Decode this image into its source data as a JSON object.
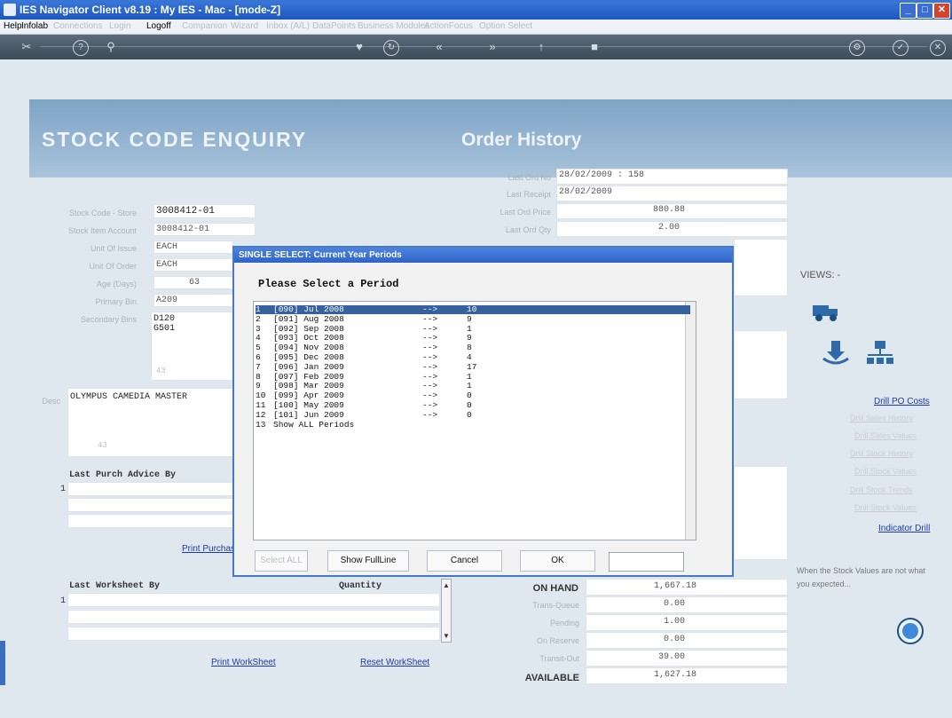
{
  "window": {
    "title": "IES Navigator Client v8.19 : My IES - Mac -     [mode-Z]"
  },
  "menu": [
    {
      "label": "Help",
      "on": true
    },
    {
      "label": "Infolab",
      "on": true
    },
    {
      "label": "Connections",
      "on": false
    },
    {
      "label": "Login",
      "on": false
    },
    {
      "label": "Logoff",
      "on": true
    },
    {
      "label": "Companion",
      "on": false
    },
    {
      "label": "Wizard",
      "on": false
    },
    {
      "label": "Inbox (A/L)",
      "on": false
    },
    {
      "label": "DataPoints",
      "on": false
    },
    {
      "label": "Business Modules",
      "on": false
    },
    {
      "label": "ActionFocus",
      "on": false
    },
    {
      "label": "Option Select",
      "on": false
    }
  ],
  "header": {
    "title": "STOCK   CODE   ENQUIRY",
    "subtitle": "Order History"
  },
  "left_fields": [
    {
      "label": "Stock Code - Store",
      "value": "3008412-01"
    },
    {
      "label": "Stock Item Account",
      "value": "3008412-01"
    },
    {
      "label": "Unit Of Issue",
      "value": "EACH"
    },
    {
      "label": "Unit Of Order",
      "value": "EACH"
    },
    {
      "label": "Age (Days)",
      "value": "63"
    },
    {
      "label": "Primary Bin",
      "value": "A209"
    },
    {
      "label": "Secondary Bins",
      "value": "D120\nG501"
    }
  ],
  "bins_extra": "43",
  "desc": {
    "label": "Desc",
    "value": "OLYMPUS CAMEDIA MASTER",
    "extra": "43"
  },
  "order_history": [
    {
      "label": "Last Ord No",
      "value": "28/02/2009 : 158"
    },
    {
      "label": "Last Receipt",
      "value": "28/02/2009"
    },
    {
      "label": "Last Ord Price",
      "value": "880.88"
    },
    {
      "label": "Last Ord Qty",
      "value": "2.00"
    }
  ],
  "purch_advice": {
    "header": "Last Purch Advice  By",
    "row_num": "1",
    "link": "Print Purchase"
  },
  "worksheet": {
    "header": "Last Worksheet   By",
    "qty_header": "Quantity",
    "row_num": "1",
    "link_print": "Print WorkSheet",
    "link_reset": "Reset WorkSheet"
  },
  "summary": {
    "on_hand_label": "ON HAND",
    "on_hand": "1,667.18",
    "rows": [
      {
        "label": "Trans-Queue",
        "value": "0.00"
      },
      {
        "label": "Pending",
        "value": "1.00"
      },
      {
        "label": "On Reserve",
        "value": "0.00"
      },
      {
        "label": "Transit-Out",
        "value": "39.00"
      }
    ],
    "available_label": "AVAILABLE",
    "available": "1,627.18"
  },
  "views": {
    "title": "VIEWS: -",
    "link": "Drill PO Costs",
    "faint_links": [
      "Drill Sales History",
      "Drill Sales Values",
      "Drill Stock History",
      "Drill Stock Values",
      "Drill Stock Trends",
      "Drill Stock Values"
    ],
    "indicator": "Indicator Drill",
    "hint": "When the Stock Values are not what you expected..."
  },
  "dialog": {
    "title": "SINGLE SELECT: Current Year Periods",
    "heading": "Please Select a Period",
    "rows": [
      {
        "n": "1",
        "period": "[090] Jul 2008",
        "arrow": "-->",
        "count": "10"
      },
      {
        "n": "2",
        "period": "[091] Aug 2008",
        "arrow": "-->",
        "count": "9"
      },
      {
        "n": "3",
        "period": "[092] Sep 2008",
        "arrow": "-->",
        "count": "1"
      },
      {
        "n": "4",
        "period": "[093] Oct 2008",
        "arrow": "-->",
        "count": "9"
      },
      {
        "n": "5",
        "period": "[094] Nov 2008",
        "arrow": "-->",
        "count": "8"
      },
      {
        "n": "6",
        "period": "[095] Dec 2008",
        "arrow": "-->",
        "count": "4"
      },
      {
        "n": "7",
        "period": "[096] Jan 2009",
        "arrow": "-->",
        "count": "17"
      },
      {
        "n": "8",
        "period": "[097] Feb 2009",
        "arrow": "-->",
        "count": "1"
      },
      {
        "n": "9",
        "period": "[098] Mar 2009",
        "arrow": "-->",
        "count": "1"
      },
      {
        "n": "10",
        "period": "[099] Apr 2009",
        "arrow": "-->",
        "count": "0"
      },
      {
        "n": "11",
        "period": "[100] May 2009",
        "arrow": "-->",
        "count": "0"
      },
      {
        "n": "12",
        "period": "[101] Jun 2009",
        "arrow": "-->",
        "count": "0"
      },
      {
        "n": "13",
        "period": "Show ALL Periods",
        "arrow": "",
        "count": ""
      }
    ],
    "selected_index": 0,
    "buttons": {
      "select_all": "Select ALL",
      "show_full": "Show FullLine",
      "cancel": "Cancel",
      "ok": "OK"
    },
    "input_value": ""
  },
  "colors": {
    "accent": "#2f63c6",
    "selection": "#35619f",
    "link": "#1e3aa8"
  }
}
